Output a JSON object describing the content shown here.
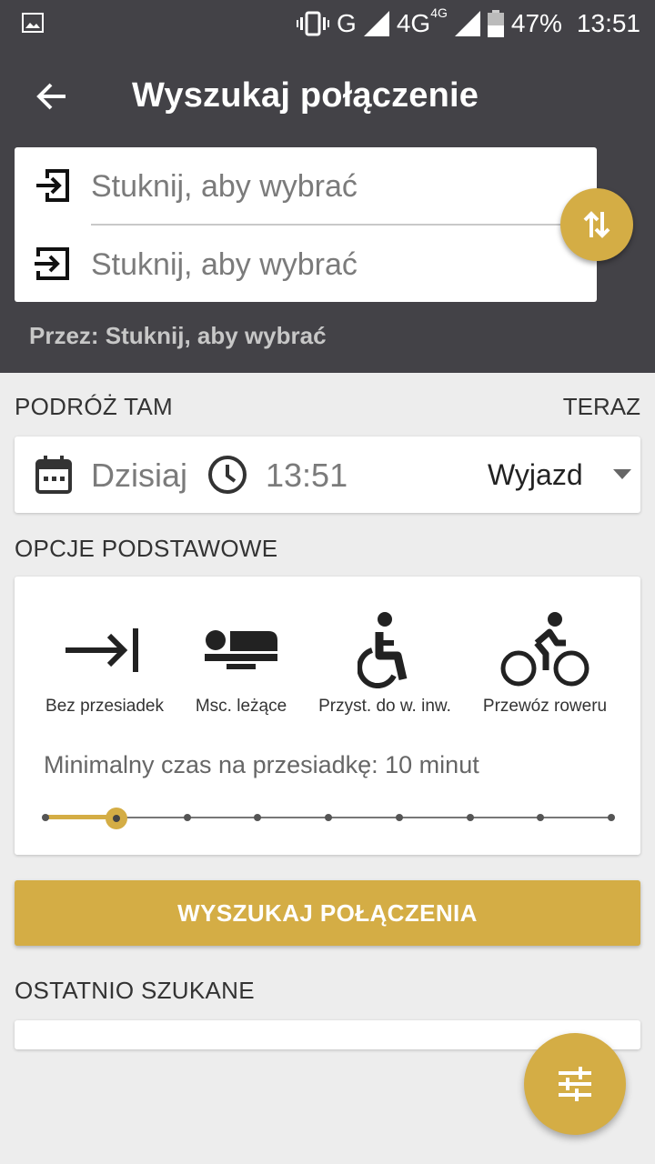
{
  "status_bar": {
    "network": "G",
    "network_lte": "4G",
    "network_lte_small": "4G",
    "battery": "47%",
    "time": "13:51"
  },
  "header": {
    "title": "Wyszukaj połączenie",
    "from_placeholder": "Stuknij, aby wybrać",
    "to_placeholder": "Stuknij, aby wybrać",
    "via_text": "Przez: Stuknij, aby wybrać"
  },
  "journey": {
    "section_label": "PODRÓŻ TAM",
    "now_label": "TERAZ",
    "date": "Dzisiaj",
    "time": "13:51",
    "mode": "Wyjazd"
  },
  "options": {
    "section_label": "OPCJE PODSTAWOWE",
    "items": [
      {
        "label": "Bez przesiadek",
        "icon": "no-transfer-icon"
      },
      {
        "label": "Msc. leżące",
        "icon": "sleeper-icon"
      },
      {
        "label": "Przyst. do w. inw.",
        "icon": "wheelchair-icon"
      },
      {
        "label": "Przewóz roweru",
        "icon": "bicycle-icon"
      }
    ],
    "min_transfer_text": "Minimalny czas na przesiadkę: 10 minut",
    "slider_steps": 9,
    "slider_selected_index": 1
  },
  "search_button": "WYSZUKAJ POŁĄCZENIA",
  "recent": {
    "section_label": "OSTATNIO SZUKANE"
  },
  "colors": {
    "header_bg": "#434247",
    "accent": "#d4ad45",
    "page_bg": "#ededed"
  }
}
